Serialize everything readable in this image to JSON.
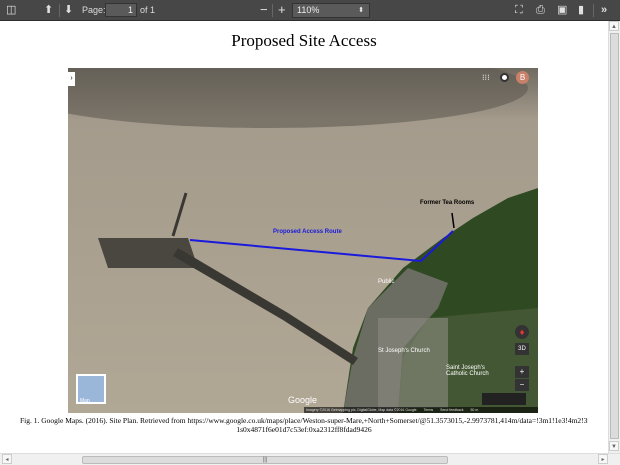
{
  "toolbar": {
    "page_label": "Page:",
    "page_value": "1",
    "page_of": "of 1",
    "zoom_value": "110%",
    "zoom_out": "−",
    "zoom_in": "+"
  },
  "document": {
    "title": "Proposed Site Access",
    "caption_line1": "Fig. 1. Google Maps. (2016). Site Plan. Retrieved from https://www.google.co.uk/maps/place/Weston-super-Mare,+North+Somerset/@51.3573015,-2.9973781,414m/data=!3m1!1e3!4m2!3m1!",
    "caption_line2": "1s0x4871f6e01d7c53ef:0xa2312ff8fdad9426"
  },
  "map": {
    "route_label": "Proposed Access Route",
    "tea_rooms_label": "Former Tea Rooms",
    "public_label": "Public",
    "church1_label": "St Joseph's Church",
    "church2_label": "Saint Joseph's Catholic Church",
    "google_logo": "Google",
    "map_toggle": "Map",
    "tilt_label": "3D",
    "zoom_in": "+",
    "zoom_out": "−",
    "attribution": "Imagery ©2016 Getmapping plc, DigitalGlobe, Map data ©2016 Google",
    "terms": "Terms",
    "feedback": "Send feedback",
    "scale": "50 m",
    "avatar_letter": "B",
    "route_color": "#1a1adc"
  }
}
